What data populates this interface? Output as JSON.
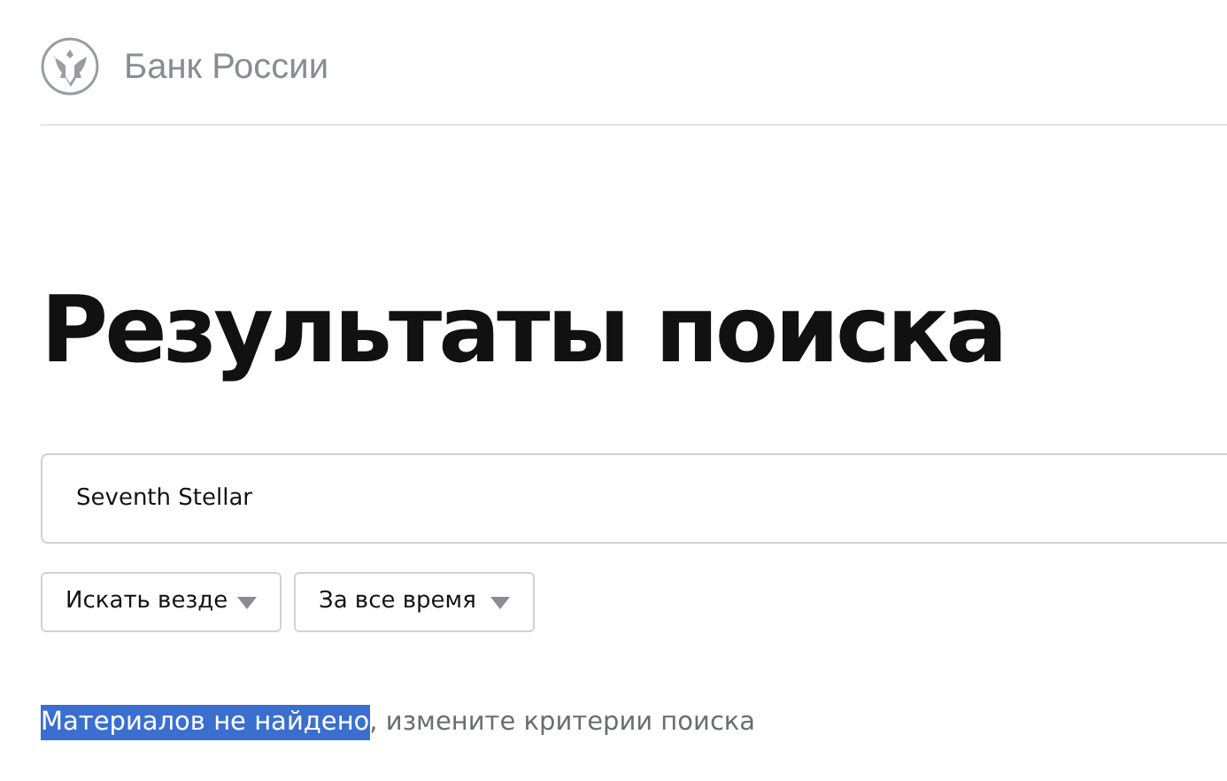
{
  "header": {
    "brand": "Банк России"
  },
  "title": "Результаты поиска",
  "search": {
    "value": "Seventh Stellar"
  },
  "filters": [
    {
      "label": "Искать везде"
    },
    {
      "label": "За все время"
    }
  ],
  "message": {
    "highlighted": "Материалов не найдено",
    "rest": ", измените критерии поиска"
  }
}
